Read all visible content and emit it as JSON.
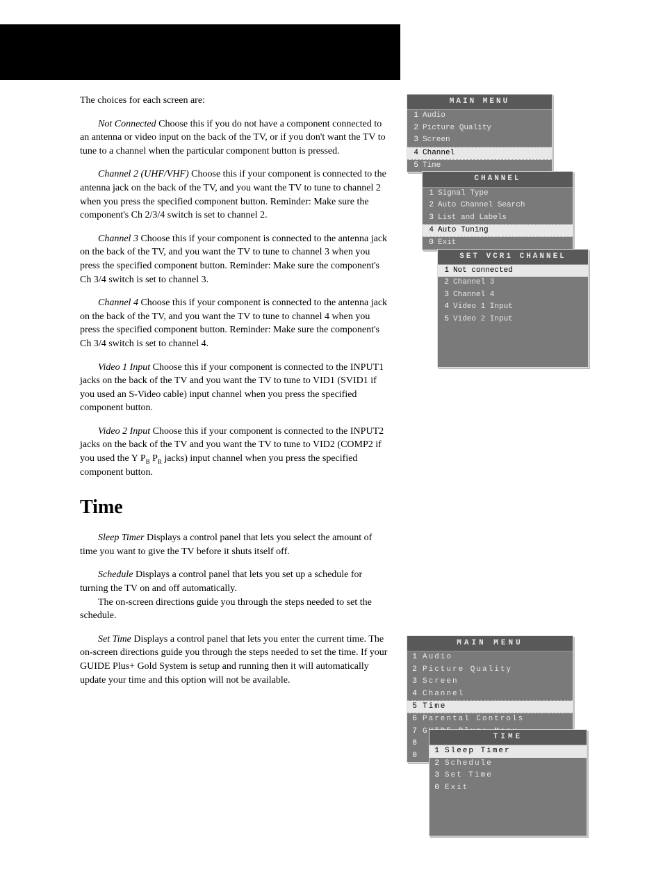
{
  "body": {
    "intro": "The choices for each screen are:",
    "opt1_term": "Not Connected",
    "opt1_text": "Choose this if you do not have a component connected to an antenna or video input on the back of the TV, or if you don't want the TV to tune to a channel when the particular component button is pressed.",
    "opt2_term": "Channel 2 (UHF/VHF)",
    "opt2_text": "Choose this if your component is connected to the antenna jack on the back of the TV, and you want the TV to tune to channel 2 when you press the specified component button. Reminder: Make sure the component's Ch 2/3/4 switch is set to channel 2.",
    "opt3_term": "Channel 3",
    "opt3_text": "Choose this if your component is connected to the antenna jack on the back of the TV, and you want the TV to tune to channel 3 when you press the specified component button. Reminder: Make sure the component's Ch 3/4 switch is set to channel 3.",
    "opt4_term": "Channel 4",
    "opt4_text": "Choose this if your component is connected to the antenna jack on the back of the TV, and you want the TV to tune to channel 4 when you press the specified component button. Reminder: Make sure the component's Ch 3/4 switch is set to channel 4.",
    "opt5_term": "Video 1 Input",
    "opt5_text": "Choose this if your component is connected to the INPUT1 jacks on the back of the TV and you want the TV to tune to VID1 (SVID1 if you used an S-Video cable) input channel when you press the specified component button.",
    "opt6_term": "Video 2 Input",
    "opt6_text_a": "Choose this if your component is connected to the INPUT2 jacks on the back of the TV and you want the TV to tune to VID2 (COMP2 if you used the Y P",
    "opt6_sub1": "B",
    "opt6_mid": " P",
    "opt6_sub2": "R",
    "opt6_text_b": " jacks) input channel when you press the specified component button.",
    "time_heading": "Time",
    "sleep_term": "Sleep Timer",
    "sleep_text": "Displays a control panel that lets you select the amount of time you want to give the TV before it shuts itself off.",
    "sched_term": "Schedule",
    "sched_text": "Displays a control panel that lets you set up a schedule for turning the TV on and off automatically.",
    "sched_text2": "The on-screen directions guide you through the steps needed to set the schedule.",
    "settime_term": "Set Time",
    "settime_text": "Displays a control panel that lets you enter the current time. The on-screen directions guide you through the steps needed to set the time. If your GUIDE Plus+ Gold System is setup and running then it will automatically update your time and this option will not be available."
  },
  "osd1": {
    "main_title": "MAIN MENU",
    "main": [
      {
        "n": "1",
        "label": "Audio"
      },
      {
        "n": "2",
        "label": "Picture Quality"
      },
      {
        "n": "3",
        "label": "Screen"
      },
      {
        "n": "4",
        "label": "Channel"
      },
      {
        "n": "5",
        "label": "Time"
      }
    ],
    "channel_title": "CHANNEL",
    "channel": [
      {
        "n": "1",
        "label": "Signal Type"
      },
      {
        "n": "2",
        "label": "Auto Channel Search"
      },
      {
        "n": "3",
        "label": "List and Labels"
      },
      {
        "n": "4",
        "label": "Auto Tuning"
      },
      {
        "n": "0",
        "label": "Exit"
      }
    ],
    "vcr_title": "SET VCR1 CHANNEL",
    "vcr": [
      {
        "n": "1",
        "label": "Not connected"
      },
      {
        "n": "2",
        "label": "Channel 3"
      },
      {
        "n": "3",
        "label": "Channel 4"
      },
      {
        "n": "4",
        "label": "Video 1 Input"
      },
      {
        "n": "5",
        "label": "Video 2 Input"
      }
    ]
  },
  "osd2": {
    "main_title": "MAIN MENU",
    "main": [
      {
        "n": "1",
        "label": "Audio"
      },
      {
        "n": "2",
        "label": "Picture Quality"
      },
      {
        "n": "3",
        "label": "Screen"
      },
      {
        "n": "4",
        "label": "Channel"
      },
      {
        "n": "5",
        "label": "Time"
      },
      {
        "n": "6",
        "label": "Parental Controls"
      },
      {
        "n": "7",
        "label": "GUIDE Plus+ Menu"
      },
      {
        "n": "8",
        "label": ""
      },
      {
        "n": "0",
        "label": ""
      }
    ],
    "time_title": "TIME",
    "time": [
      {
        "n": "1",
        "label": "Sleep Timer"
      },
      {
        "n": "2",
        "label": "Schedule"
      },
      {
        "n": "3",
        "label": "Set Time"
      },
      {
        "n": "0",
        "label": "Exit"
      }
    ]
  }
}
